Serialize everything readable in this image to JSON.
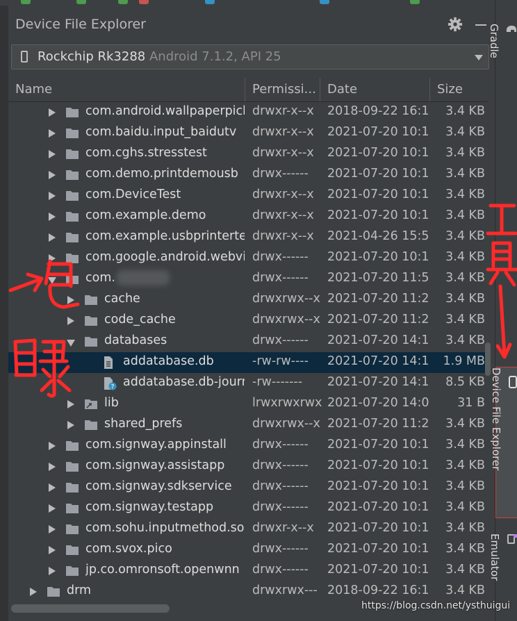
{
  "panel": {
    "title": "Device File Explorer",
    "device_name": "Rockchip Rk3288",
    "device_meta": "Android 7.1.2, API 25"
  },
  "columns": {
    "name": "Name",
    "permissions": "Permissi...",
    "date": "Date",
    "size": "Size"
  },
  "rows": [
    {
      "indent": 0,
      "name": "com.android.wallpaperpicker",
      "perm": "drwxr-x--x",
      "date": "2018-09-22 16:1",
      "size": "3.4 KB",
      "kind": "folder",
      "state": "collapsed"
    },
    {
      "indent": 0,
      "name": "com.baidu.input_baidutv",
      "perm": "drwxr-x--x",
      "date": "2021-07-20 10:1",
      "size": "3.4 KB",
      "kind": "folder",
      "state": "collapsed"
    },
    {
      "indent": 0,
      "name": "com.cghs.stresstest",
      "perm": "drwxr-x--x",
      "date": "2021-07-20 10:1",
      "size": "3.4 KB",
      "kind": "folder",
      "state": "collapsed"
    },
    {
      "indent": 0,
      "name": "com.demo.printdemousb",
      "perm": "drwx------",
      "date": "2021-07-20 10:1",
      "size": "3.4 KB",
      "kind": "folder",
      "state": "collapsed"
    },
    {
      "indent": 0,
      "name": "com.DeviceTest",
      "perm": "drwxr-x--x",
      "date": "2021-07-20 10:1",
      "size": "3.4 KB",
      "kind": "folder",
      "state": "collapsed"
    },
    {
      "indent": 0,
      "name": "com.example.demo",
      "perm": "drwxr-x--x",
      "date": "2021-07-20 10:1",
      "size": "3.4 KB",
      "kind": "folder",
      "state": "collapsed"
    },
    {
      "indent": 0,
      "name": "com.example.usbprintertest",
      "perm": "drwxr-x--x",
      "date": "2021-04-26 15:5",
      "size": "3.4 KB",
      "kind": "folder",
      "state": "collapsed"
    },
    {
      "indent": 0,
      "name": "com.google.android.webview",
      "perm": "drwx------",
      "date": "2021-07-20 10:1",
      "size": "3.4 KB",
      "kind": "folder",
      "state": "collapsed"
    },
    {
      "indent": 0,
      "name": "com.",
      "perm": "drwx------",
      "date": "2021-07-20 11:5",
      "size": "3.4 KB",
      "kind": "folder",
      "state": "expanded",
      "blurred": true
    },
    {
      "indent": 1,
      "name": "cache",
      "perm": "drwxrwx--x",
      "date": "2021-07-20 11:2",
      "size": "3.4 KB",
      "kind": "folder",
      "state": "collapsed"
    },
    {
      "indent": 1,
      "name": "code_cache",
      "perm": "drwxrwx--x",
      "date": "2021-07-20 11:2",
      "size": "3.4 KB",
      "kind": "folder",
      "state": "collapsed"
    },
    {
      "indent": 1,
      "name": "databases",
      "perm": "drwx------",
      "date": "2021-07-20 14:1",
      "size": "3.4 KB",
      "kind": "folder",
      "state": "expanded"
    },
    {
      "indent": 2,
      "name": "addatabase.db",
      "perm": "-rw-rw----",
      "date": "2021-07-20 14:1",
      "size": "1.9 MB",
      "kind": "file",
      "state": "none",
      "selected": true
    },
    {
      "indent": 2,
      "name": "addatabase.db-journal",
      "perm": "-rw-------",
      "date": "2021-07-20 14:1",
      "size": "8.5 KB",
      "kind": "file-unknown",
      "state": "none"
    },
    {
      "indent": 1,
      "name": "lib",
      "perm": "lrwxrwxrwx",
      "date": "2021-07-20 14:0",
      "size": "31 B",
      "kind": "link",
      "state": "collapsed"
    },
    {
      "indent": 1,
      "name": "shared_prefs",
      "perm": "drwxrwx--x",
      "date": "2021-07-20 11:2",
      "size": "3.4 KB",
      "kind": "folder",
      "state": "collapsed"
    },
    {
      "indent": 0,
      "name": "com.signway.appinstall",
      "perm": "drwx------",
      "date": "2021-07-20 10:1",
      "size": "3.4 KB",
      "kind": "folder",
      "state": "collapsed"
    },
    {
      "indent": 0,
      "name": "com.signway.assistapp",
      "perm": "drwx------",
      "date": "2021-07-20 10:1",
      "size": "3.4 KB",
      "kind": "folder",
      "state": "collapsed"
    },
    {
      "indent": 0,
      "name": "com.signway.sdkservice",
      "perm": "drwx------",
      "date": "2021-07-20 10:1",
      "size": "3.4 KB",
      "kind": "folder",
      "state": "collapsed"
    },
    {
      "indent": 0,
      "name": "com.signway.testapp",
      "perm": "drwx------",
      "date": "2021-07-20 10:1",
      "size": "3.4 KB",
      "kind": "folder",
      "state": "collapsed"
    },
    {
      "indent": 0,
      "name": "com.sohu.inputmethod.sogou",
      "perm": "drwxr-x--x",
      "date": "2021-07-20 10:1",
      "size": "3.4 KB",
      "kind": "folder",
      "state": "collapsed"
    },
    {
      "indent": 0,
      "name": "com.svox.pico",
      "perm": "drwx------",
      "date": "2021-07-20 10:1",
      "size": "3.4 KB",
      "kind": "folder",
      "state": "collapsed"
    },
    {
      "indent": 0,
      "name": "jp.co.omronsoft.openwnn",
      "perm": "drwx------",
      "date": "2021-07-20 10:1",
      "size": "3.4 KB",
      "kind": "folder",
      "state": "collapsed"
    },
    {
      "indent": -1,
      "name": "drm",
      "perm": "drwxrwx---",
      "date": "2018-09-22 16:1",
      "size": "3.4 KB",
      "kind": "folder",
      "state": "collapsed"
    }
  ],
  "right_toolbar": {
    "gradle": "Gradle",
    "device_file_explorer": "Device File Explorer",
    "emulator": "Emulator"
  },
  "annotations": {
    "package_label": "包",
    "directory_label": "目录",
    "tool_label": "工具",
    "color": "#ff2a2a"
  },
  "watermark": "https://blog.csdn.net/ysthuigui",
  "colors": {
    "background": "#3c3f41",
    "selection": "#0d293e",
    "folder": "#9aa0a6"
  }
}
